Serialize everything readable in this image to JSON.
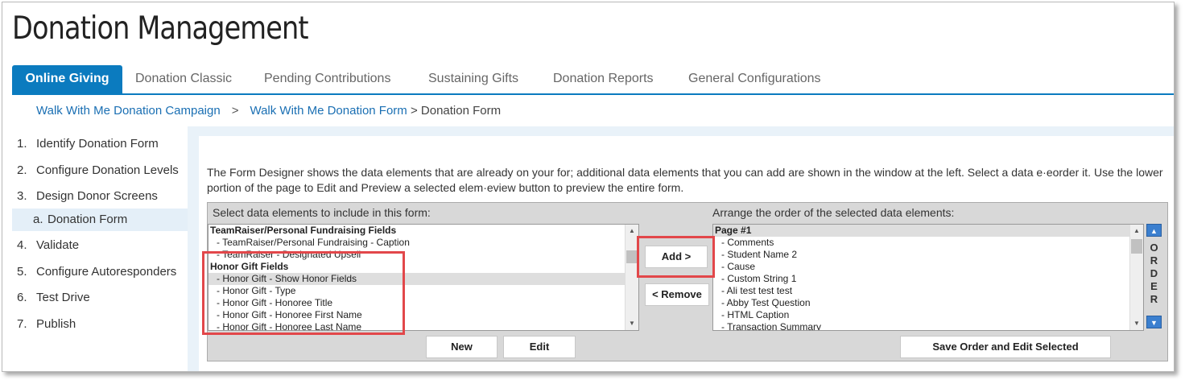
{
  "page": {
    "title": "Donation Management"
  },
  "tabs": [
    {
      "label": "Online Giving",
      "active": true
    },
    {
      "label": "Donation Classic"
    },
    {
      "label": "Pending Contributions"
    },
    {
      "label": "Sustaining Gifts"
    },
    {
      "label": "Donation Reports"
    },
    {
      "label": "General Configurations"
    }
  ],
  "breadcrumb": {
    "items": [
      "Walk With Me Donation Campaign",
      "Walk With Me Donation Form"
    ],
    "separator": ">",
    "current": "> Donation Form"
  },
  "steps": [
    {
      "num": "1.",
      "label": "Identify Donation Form"
    },
    {
      "num": "2.",
      "label": "Configure Donation Levels"
    },
    {
      "num": "3.",
      "label": "Design Donor Screens"
    },
    {
      "num": "a.",
      "label": "Donation Form"
    },
    {
      "num": "4.",
      "label": "Validate"
    },
    {
      "num": "5.",
      "label": "Configure Autoresponders"
    },
    {
      "num": "6.",
      "label": "Test Drive"
    },
    {
      "num": "7.",
      "label": "Publish"
    }
  ],
  "description": "The Form Designer shows the data elements that are already on your for; additional data elements that you can add are shown in the window at the left. Select a data e·eorder it. Use the lower portion of the page to Edit and Preview a selected elem·eview button to preview the entire form.",
  "left_panel": {
    "label": "Select data elements to include in this form:",
    "items": [
      {
        "text": "TeamRaiser/Personal Fundraising Fields",
        "header": true
      },
      {
        "text": "- TeamRaiser/Personal Fundraising - Caption"
      },
      {
        "text": "- TeamRaiser - Designated Upsell"
      },
      {
        "text": "Honor Gift Fields",
        "header": true
      },
      {
        "text": "- Honor Gift - Show Honor Fields",
        "selected": true
      },
      {
        "text": "- Honor Gift - Type"
      },
      {
        "text": "- Honor Gift - Honoree Title"
      },
      {
        "text": "- Honor Gift - Honoree First Name"
      },
      {
        "text": "- Honor Gift - Honoree Last Name"
      }
    ]
  },
  "right_panel": {
    "label": "Arrange the order of the selected data elements:",
    "items": [
      {
        "text": "Page #1",
        "header": true,
        "selected": true
      },
      {
        "text": "- Comments"
      },
      {
        "text": "- Student Name 2"
      },
      {
        "text": "- Cause"
      },
      {
        "text": "- Custom String 1"
      },
      {
        "text": "- Ali test test test"
      },
      {
        "text": "- Abby Test Question"
      },
      {
        "text": "- HTML Caption"
      },
      {
        "text": "- Transaction Summary"
      }
    ]
  },
  "buttons": {
    "add": "Add >",
    "remove": "< Remove",
    "new": "New",
    "edit": "Edit",
    "save_order": "Save Order and Edit Selected"
  },
  "order_label": "O R D E R",
  "icons": {
    "scroll_up": "scroll-up-arrow-icon",
    "scroll_down": "scroll-down-arrow-icon",
    "order_up": "move-up-icon",
    "order_down": "move-down-icon"
  },
  "colors": {
    "accent": "#0b7bbf",
    "link": "#1a6fb3",
    "highlight": "#e2474a"
  }
}
